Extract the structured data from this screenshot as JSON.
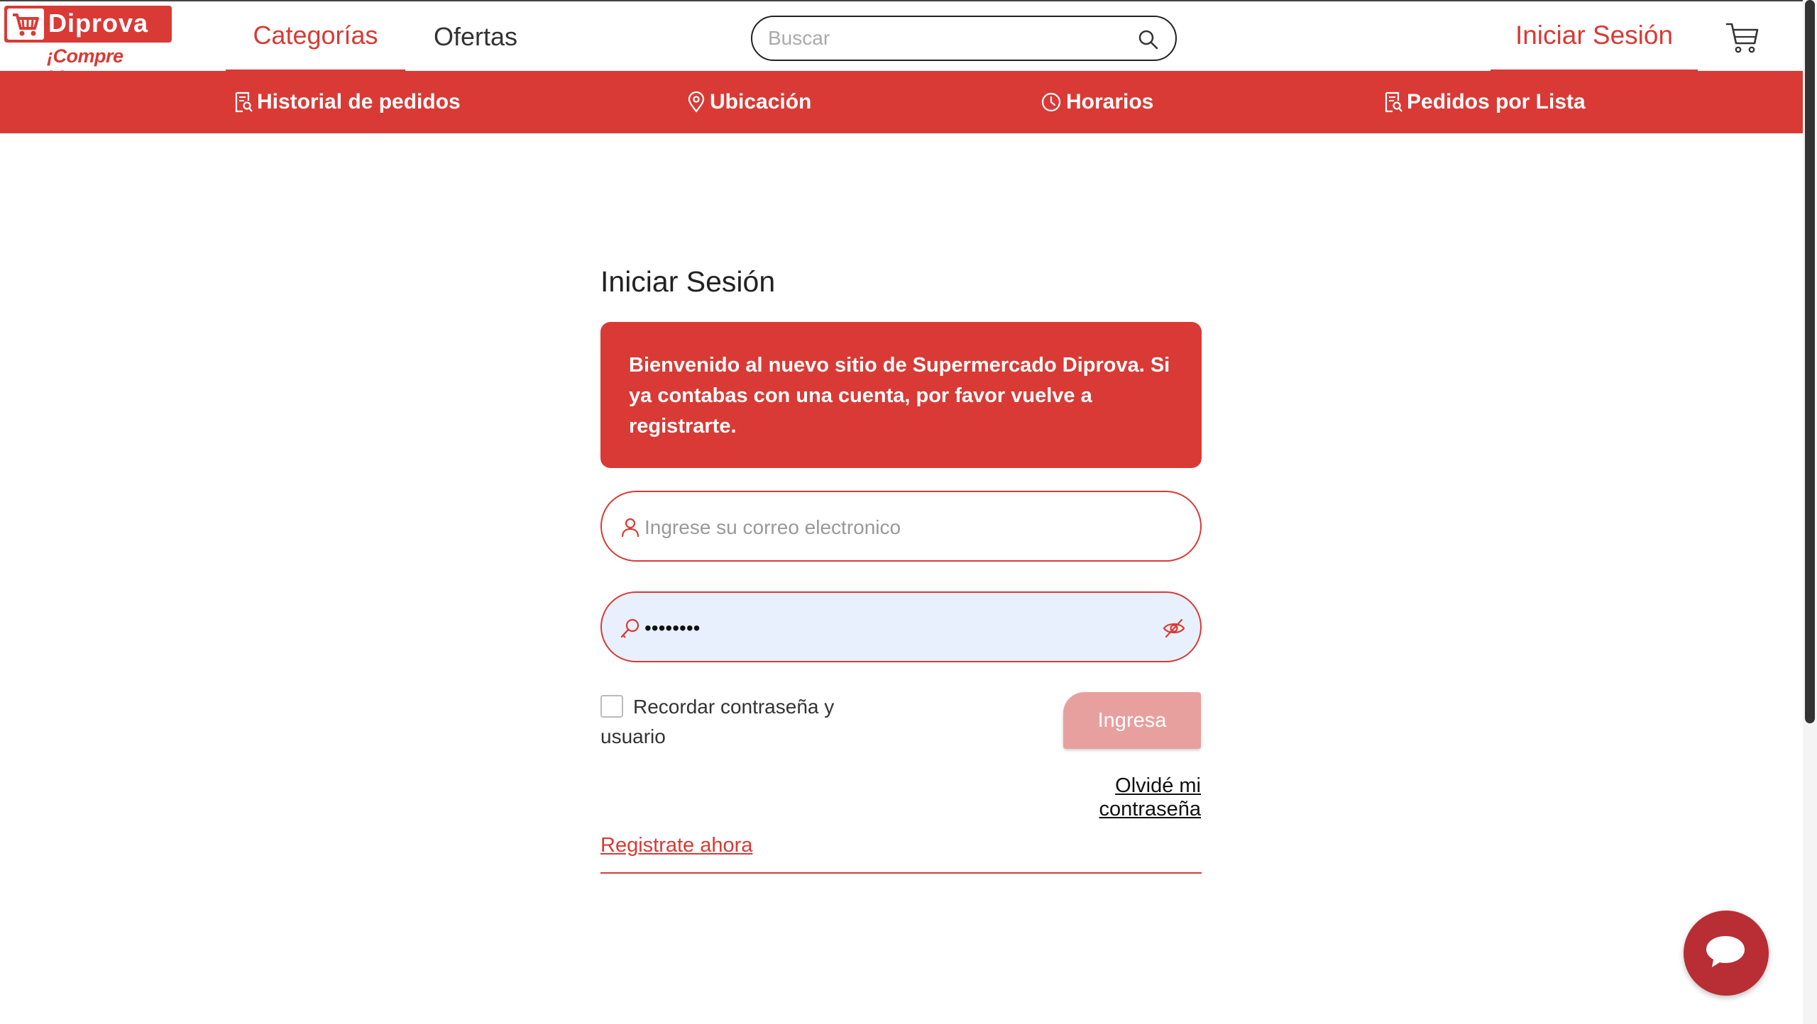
{
  "brand": {
    "name": "Diprova",
    "slogan": "¡Compre bien!",
    "color": "#d93a35"
  },
  "header": {
    "tabs": [
      {
        "label": "Categorías",
        "active": true
      },
      {
        "label": "Ofertas",
        "active": false
      }
    ],
    "search": {
      "placeholder": "Buscar",
      "value": "",
      "icon": "search-icon"
    },
    "login_label": "Iniciar Sesión",
    "cart_icon": "cart-icon"
  },
  "subnav": {
    "items": [
      {
        "label": "Historial de pedidos",
        "icon": "receipt-icon"
      },
      {
        "label": "Ubicación",
        "icon": "location-pin-icon"
      },
      {
        "label": "Horarios",
        "icon": "clock-icon"
      },
      {
        "label": "Pedidos por Lista",
        "icon": "receipt-icon"
      }
    ]
  },
  "login": {
    "title": "Iniciar Sesión",
    "notice": "Bienvenido al nuevo sitio de Supermercado Diprova. Si ya contabas con una cuenta, por favor vuelve a registrarte.",
    "email": {
      "placeholder": "Ingrese su correo electronico",
      "value": "",
      "icon": "user-icon"
    },
    "password": {
      "value": "••••••••",
      "icon": "key-icon",
      "toggle_icon": "eye-off-icon"
    },
    "remember_label": "Recordar contraseña y usuario",
    "remember_checked": false,
    "submit_label": "Ingresa",
    "forgot_label": "Olvidé mi contraseña",
    "register_label": "Registrate ahora"
  },
  "chat": {
    "icon": "chat-bubble-icon"
  }
}
